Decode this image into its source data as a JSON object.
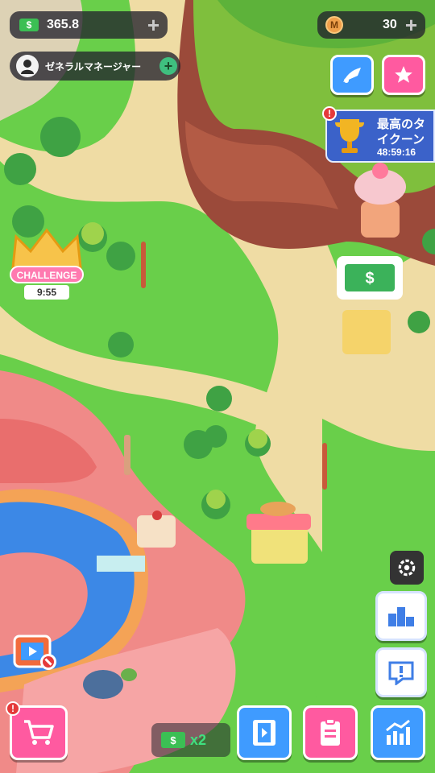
{
  "hud": {
    "cash_value": "365.8",
    "coin_value": "30",
    "plus_symbol": "+",
    "manager_label": "ゼネラルマネージャー"
  },
  "challenge": {
    "label": "CHALLENGE",
    "timer": "9:55"
  },
  "event": {
    "title_line1": "最高のタ",
    "title_line2": "イクーン",
    "timer": "48:59:16"
  },
  "boost": {
    "multiplier": "x2"
  },
  "icons": {
    "cash": "cash-icon",
    "coin": "coin-icon",
    "trophy": "trophy-icon",
    "settings": "gear-icon",
    "shop": "cart-icon",
    "video": "film-icon",
    "tasks": "clipboard-icon",
    "stats": "chart-icon",
    "leaderboard": "podium-icon",
    "alert": "exclamation-icon"
  },
  "colors": {
    "green_button": "#3fbf7f",
    "pink_button": "#ff5aa0",
    "blue_button": "#3f9bff",
    "path": "#efdca4",
    "grass": "#6cd24c"
  }
}
